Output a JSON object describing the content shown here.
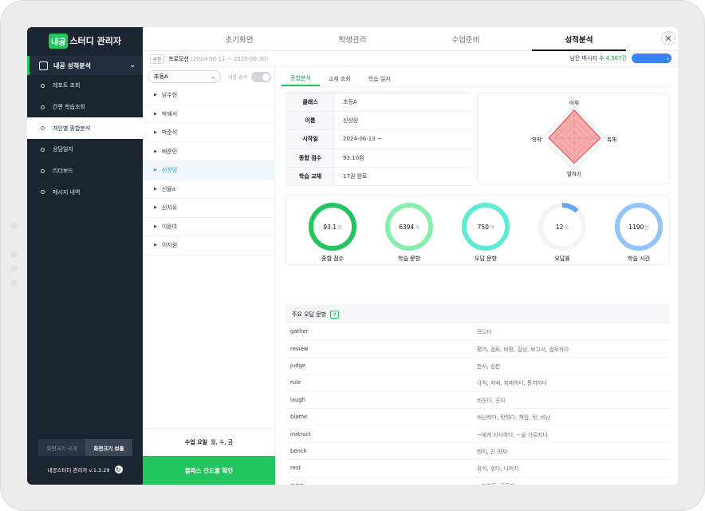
{
  "app": {
    "logo_badge": "내공",
    "logo_text": "스터디 관리자",
    "version": "내공스터디 관리자 v.1.3.29"
  },
  "sidebar": {
    "section_title": "내공 성적분석",
    "items": [
      {
        "label": "레포트 조회"
      },
      {
        "label": "간편 학습조회"
      },
      {
        "label": "개인별 종합분석"
      },
      {
        "label": "상담일지"
      },
      {
        "label": "리더보드"
      },
      {
        "label": "메시지 내역"
      }
    ],
    "zoom_small": "화면크기 크게",
    "zoom_normal": "화면크기 보통"
  },
  "top_tabs": [
    "초기화면",
    "학생관리",
    "수업준비",
    "성적분석"
  ],
  "subheader": {
    "tag": "분원",
    "program": "프로모션",
    "dates": "(2024-06-11 ~ 2025-06-30)",
    "remaining_label": "남은 메시지 수",
    "remaining_count": "4,987건"
  },
  "student_panel": {
    "class_select": "초등A",
    "name_search_label": "이름 검색",
    "students": [
      "남수현",
      "박예서",
      "박준석",
      "배준민",
      "신상원",
      "신율a",
      "신지유",
      "이윤아",
      "이지원"
    ],
    "days_label": "수업 요일",
    "days_value": "월, 수, 금",
    "progress_button": "클래스 진도율 확인"
  },
  "content": {
    "subtabs": [
      "종합분석",
      "교재 조회",
      "학습 일지"
    ],
    "info": [
      {
        "key": "클래스",
        "value": "초등A"
      },
      {
        "key": "이름",
        "value": "신상원"
      },
      {
        "key": "시작일",
        "value": "2024-06-13 ~"
      },
      {
        "key": "종합 점수",
        "value": "93.10점"
      },
      {
        "key": "학습 교재",
        "value": "17권 완료"
      }
    ],
    "radar": {
      "axes": [
        "어휘",
        "독해",
        "말하기",
        "영작"
      ],
      "values": [
        0.88,
        0.82,
        0.78,
        0.8
      ]
    },
    "stats": [
      {
        "label": "종합 점수",
        "value": "93.1",
        "unit": "점",
        "fraction": 1.0,
        "color": "#22c55e"
      },
      {
        "label": "학습 문항",
        "value": "6394",
        "unit": "개",
        "fraction": 1.0,
        "color": "#86efac"
      },
      {
        "label": "오답 문항",
        "value": "750",
        "unit": "개",
        "fraction": 1.0,
        "color": "#5eead4"
      },
      {
        "label": "오답률",
        "value": "12",
        "unit": "%",
        "fraction": 0.12,
        "color": "#60a5fa"
      },
      {
        "label": "학습 시간",
        "value": "1190",
        "unit": "분",
        "fraction": 1.0,
        "color": "#93c5fd"
      }
    ],
    "wrong_title": "주요 오답 문항",
    "wrong_items": [
      {
        "word": "gather",
        "meaning": "모으다"
      },
      {
        "word": "review",
        "meaning": "평가, 검토, 비평, 감상, 보고서, 검토하다"
      },
      {
        "word": "judge",
        "meaning": "판사, 심판"
      },
      {
        "word": "rule",
        "meaning": "규칙, 지배, 지배하다, 통치하다"
      },
      {
        "word": "laugh",
        "meaning": "비웃다, 웃다"
      },
      {
        "word": "blame",
        "meaning": "비난하다, 탓하다, 책임, 탓, 비난"
      },
      {
        "word": "instruct",
        "meaning": "~에게 지시하다, ~을 가르치다"
      },
      {
        "word": "bench",
        "meaning": "벤치, 긴 의자"
      },
      {
        "word": "rest",
        "meaning": "휴식, 쉬다, 나머지"
      },
      {
        "word": "even",
        "meaning": "~조차도, 균등한"
      }
    ]
  }
}
